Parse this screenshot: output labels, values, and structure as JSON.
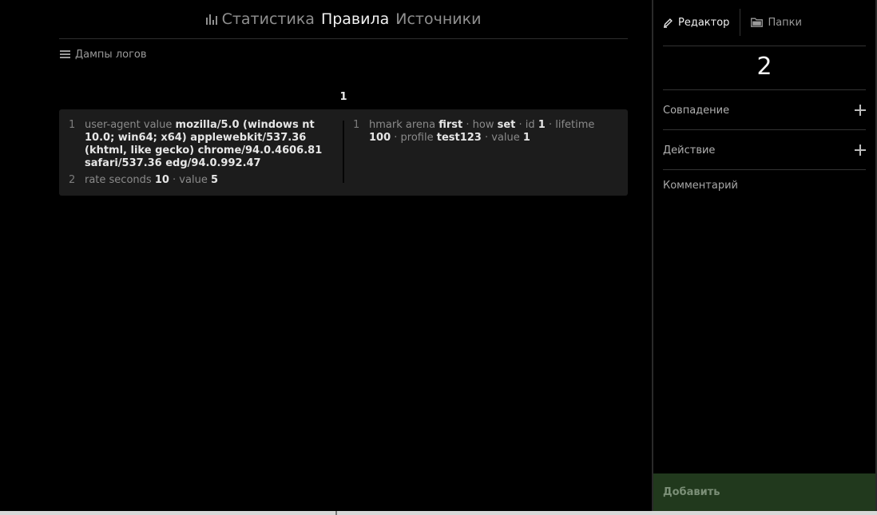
{
  "nav": {
    "tabs": [
      {
        "label": "Статистика",
        "icon": "bar-chart-icon",
        "active": false
      },
      {
        "label": "Правила",
        "active": true
      },
      {
        "label": "Источники",
        "active": false
      }
    ]
  },
  "dumps": {
    "label": "Дампы логов",
    "icon": "list-icon"
  },
  "rule": {
    "number": "1",
    "conditions": [
      {
        "num": "1",
        "parts": [
          {
            "t": "user-agent value ",
            "b": false
          },
          {
            "t": "mozilla/5.0 (windows nt 10.0; win64; x64) applewebkit/537.36 (khtml, like gecko) chrome/94.0.4606.81 safari/537.36 edg/94.0.992.47",
            "b": true
          }
        ]
      },
      {
        "num": "2",
        "parts": [
          {
            "t": "rate seconds ",
            "b": false
          },
          {
            "t": "10",
            "b": true
          },
          {
            "t": " · value ",
            "b": false
          },
          {
            "t": "5",
            "b": true
          }
        ]
      }
    ],
    "actions": [
      {
        "num": "1",
        "parts": [
          {
            "t": "hmark arena ",
            "b": false
          },
          {
            "t": "first",
            "b": true
          },
          {
            "t": " · how ",
            "b": false
          },
          {
            "t": "set",
            "b": true
          },
          {
            "t": " · id ",
            "b": false
          },
          {
            "t": "1",
            "b": true
          },
          {
            "t": " · lifetime ",
            "b": false
          },
          {
            "t": "100",
            "b": true
          },
          {
            "t": " · profile ",
            "b": false
          },
          {
            "t": "test123",
            "b": true
          },
          {
            "t": " · value ",
            "b": false
          },
          {
            "t": "1",
            "b": true
          }
        ]
      }
    ]
  },
  "side": {
    "tabs": [
      {
        "label": "Редактор",
        "icon": "pencil-icon",
        "active": true
      },
      {
        "label": "Папки",
        "icon": "folder-icon",
        "active": false
      }
    ],
    "rule_id": "2",
    "sections": [
      {
        "label": "Совпадение",
        "icon": "plus-icon"
      },
      {
        "label": "Действие",
        "icon": "plus-icon"
      }
    ],
    "comment_label": "Комментарий",
    "add_button": "Добавить"
  },
  "colors": {
    "background": "#000000",
    "card": "#1c1c1c",
    "add_button_bg": "#21391d",
    "add_button_text": "#7b8f77"
  }
}
